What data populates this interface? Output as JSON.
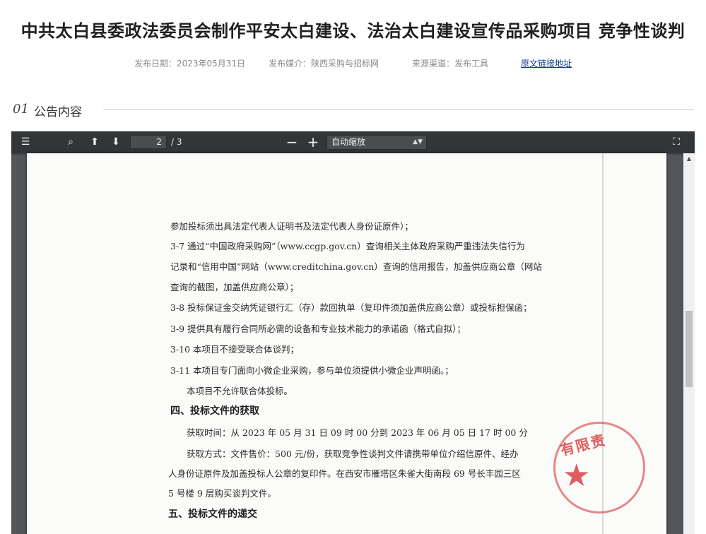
{
  "page": {
    "title": "中共太白县委政法委员会制作平安太白建设、法治太白建设宣传品采购项目 竞争性谈判",
    "meta": {
      "publish_date": "发布日期：2023年05月31日",
      "media": "发布媒介：陕西采购与招标网",
      "channel": "来源渠道：发布工具",
      "source_link": "原文链接地址"
    }
  },
  "section": {
    "number": "01",
    "label": "公告内容"
  },
  "viewer": {
    "toolbar": {
      "sidebar_icon": "☰",
      "search_icon": "⌕",
      "up_icon": "⬆",
      "down_icon": "⬇",
      "current_page": "2",
      "total_pages": "/ 3",
      "zoom_out_icon": "−",
      "zoom_in_icon": "+",
      "zoom_value": "自动缩放",
      "fullscreen_icon": "⛶"
    },
    "document_lines": [
      "参加投标须出具法定代表人证明书及法定代表人身份证原件）；",
      "3-7 通过“中国政府采购网”（www.ccgp.gov.cn）查询相关主体政府采购严重违法失信行为",
      "记录和“信用中国”网站（www.creditchina.gov.cn）查询的信用报告，加盖供应商公章（网站",
      "查询的截图，加盖供应商公章）；",
      "3-8 投标保证金交纳凭证银行汇（存）款回执单（复印件须加盖供应商公章）或投标担保函；",
      "3-9 提供具有履行合同所必需的设备和专业技术能力的承诺函（格式自拟）；",
      "3-10 本项目不接受联合体谈判；",
      "3-11 本项目专门面向小微企业采购，参与单位须提供小微企业声明函。；",
      "本项目不允许联合体投标。",
      "四、投标文件的获取",
      "获取时间：从 2023 年 05 月 31 日 09 时 00 分到 2023 年 06 月 05 日 17 时 00 分",
      "获取方式：文件售价：500 元/份，获取竞争性谈判文件请携带单位介绍信原件、经办",
      "人身份证原件及加盖投标人公章的复印件。在西安市雁塔区朱雀大街南段 69 号长丰园三区",
      "5 号楼 9 层购买谈判文件。",
      "五、投标文件的递交"
    ],
    "stamp_text": "有限责"
  }
}
